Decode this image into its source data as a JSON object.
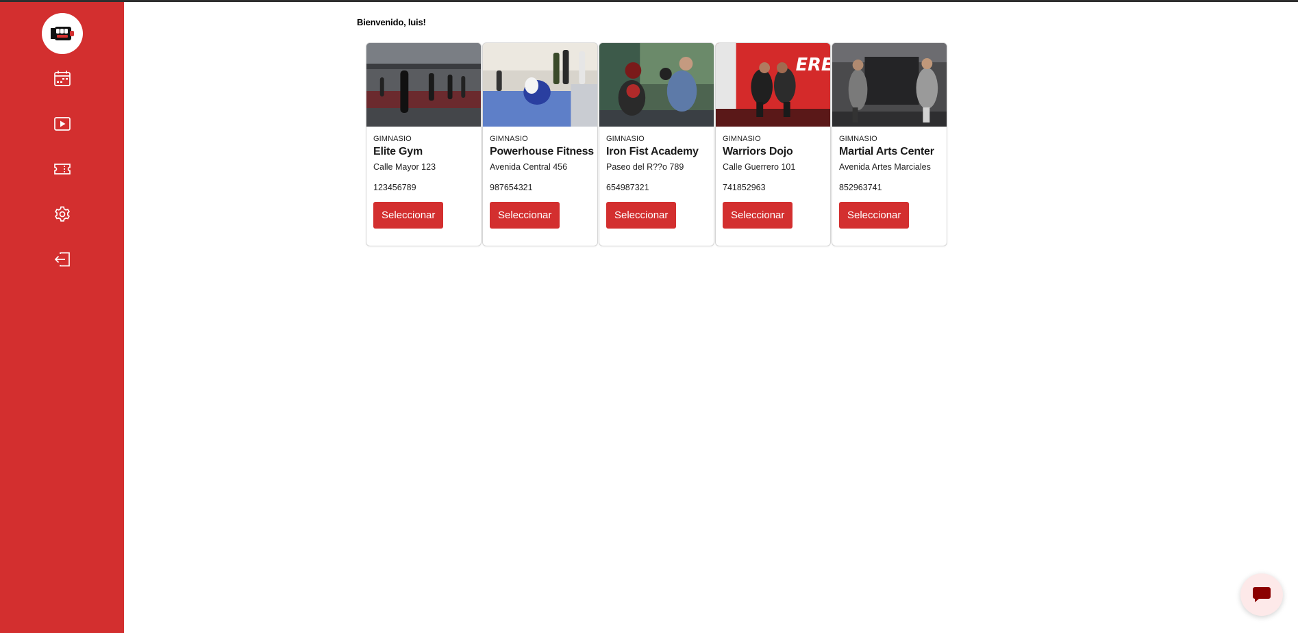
{
  "header": {
    "welcome": "Bienvenido, luis!"
  },
  "sidebar": {
    "logo": "fist-logo",
    "items": [
      {
        "icon": "calendar-icon"
      },
      {
        "icon": "play-icon"
      },
      {
        "icon": "ticket-icon"
      },
      {
        "icon": "gear-icon"
      },
      {
        "icon": "logout-icon"
      }
    ]
  },
  "gyms": [
    {
      "category": "GIMNASIO",
      "name": "Elite Gym",
      "address": "Calle Mayor 123",
      "phone": "123456789",
      "button": "Seleccionar"
    },
    {
      "category": "GIMNASIO",
      "name": "Powerhouse Fitness",
      "address": "Avenida Central 456",
      "phone": "987654321",
      "button": "Seleccionar"
    },
    {
      "category": "GIMNASIO",
      "name": "Iron Fist Academy",
      "address": "Paseo del R??o 789",
      "phone": "654987321",
      "button": "Seleccionar"
    },
    {
      "category": "GIMNASIO",
      "name": "Warriors Dojo",
      "address": "Calle Guerrero 101",
      "phone": "741852963",
      "button": "Seleccionar"
    },
    {
      "category": "GIMNASIO",
      "name": "Martial Arts Center",
      "address": "Avenida Artes Marciales",
      "phone": "852963741",
      "button": "Seleccionar"
    }
  ],
  "chat": {
    "icon": "chat-icon"
  },
  "colors": {
    "brand": "#d32f2f",
    "chat_bg": "#fde9e9",
    "chat_icon": "#8b0000"
  }
}
